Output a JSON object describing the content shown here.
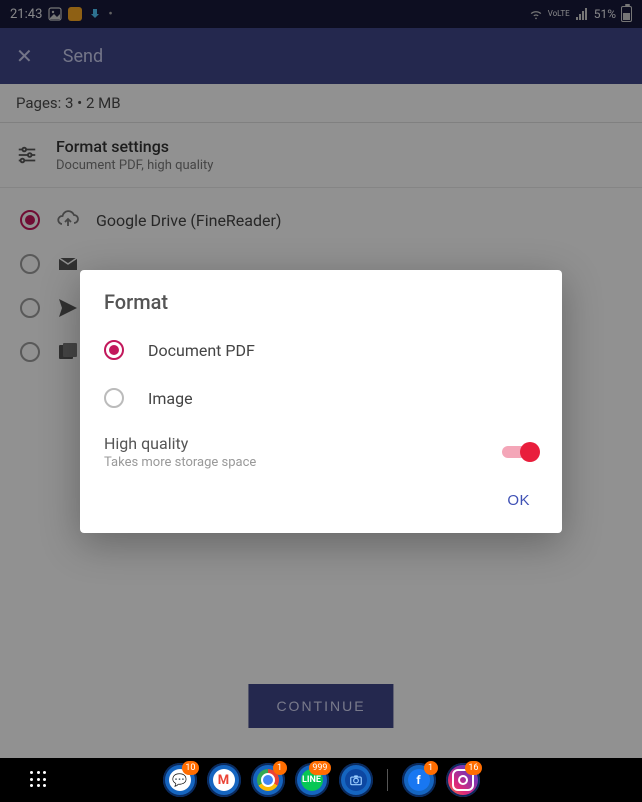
{
  "status": {
    "time": "21:43",
    "net_label": "VoLTE",
    "battery_pct": "51%"
  },
  "header": {
    "title": "Send"
  },
  "subheader": {
    "pages_info": "Pages: 3 • 2 MB"
  },
  "format_settings": {
    "title": "Format settings",
    "subtitle": "Document PDF, high quality"
  },
  "destinations": {
    "items": [
      {
        "label": "Google Drive (FineReader)",
        "selected": true
      },
      {
        "label": "",
        "selected": false
      },
      {
        "label": "",
        "selected": false
      },
      {
        "label": "",
        "selected": false
      }
    ]
  },
  "continue_label": "CONTINUE",
  "dialog": {
    "title": "Format",
    "options": [
      {
        "label": "Document PDF",
        "selected": true
      },
      {
        "label": "Image",
        "selected": false
      }
    ],
    "high_quality": {
      "title": "High quality",
      "subtitle": "Takes more storage space",
      "enabled": true
    },
    "ok_label": "OK"
  },
  "nav": {
    "badges": {
      "chat": "10",
      "chrome": "1",
      "line": "999",
      "fb": "1",
      "ig": "16"
    }
  }
}
